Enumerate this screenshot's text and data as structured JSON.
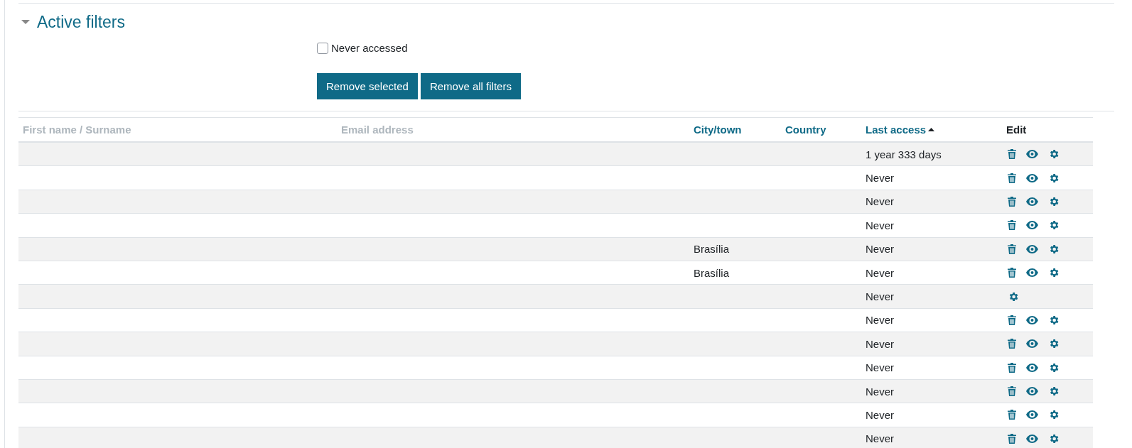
{
  "section": {
    "title": "Active filters",
    "expanded": true
  },
  "filters": [
    {
      "label": "Never accessed",
      "checked": false
    }
  ],
  "buttons": [
    "Remove selected",
    "Remove all filters"
  ],
  "table": {
    "columns": [
      {
        "label": "First name / Surname",
        "kind": "blurred"
      },
      {
        "label": "Email address",
        "kind": "blurred"
      },
      {
        "label": "City/town",
        "kind": "link"
      },
      {
        "label": "Country",
        "kind": "link"
      },
      {
        "label": "Last access",
        "kind": "link",
        "sorted": true
      },
      {
        "label": "Edit",
        "kind": "plain"
      }
    ],
    "rows": [
      {
        "city": "",
        "last_access": "1 year 333 days",
        "deletable": true,
        "viewable": true
      },
      {
        "city": "",
        "last_access": "Never",
        "deletable": true,
        "viewable": true
      },
      {
        "city": "",
        "last_access": "Never",
        "deletable": true,
        "viewable": true
      },
      {
        "city": "",
        "last_access": "Never",
        "deletable": true,
        "viewable": true
      },
      {
        "city": "Brasília",
        "last_access": "Never",
        "deletable": true,
        "viewable": true
      },
      {
        "city": "Brasília",
        "last_access": "Never",
        "deletable": true,
        "viewable": true
      },
      {
        "city": "",
        "last_access": "Never",
        "deletable": false,
        "viewable": false
      },
      {
        "city": "",
        "last_access": "Never",
        "deletable": true,
        "viewable": true
      },
      {
        "city": "",
        "last_access": "Never",
        "deletable": true,
        "viewable": true
      },
      {
        "city": "",
        "last_access": "Never",
        "deletable": true,
        "viewable": true
      },
      {
        "city": "",
        "last_access": "Never",
        "deletable": true,
        "viewable": true
      },
      {
        "city": "",
        "last_access": "Never",
        "deletable": true,
        "viewable": true
      },
      {
        "city": "",
        "last_access": "Never",
        "deletable": true,
        "viewable": true
      }
    ]
  }
}
